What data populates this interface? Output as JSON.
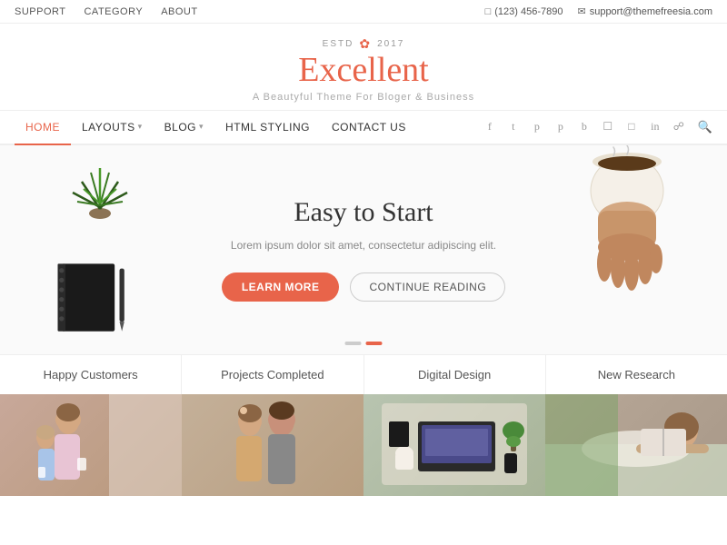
{
  "topbar": {
    "links": [
      "SUPPORT",
      "CATEGORY",
      "ABOUT"
    ],
    "phone": "(123) 456-7890",
    "email": "support@themefreesia.com"
  },
  "logo": {
    "estd": "ESTD",
    "year": "2017",
    "title_prefix": "E",
    "title_rest": "xcellent",
    "tagline": "A Beautyful Theme For Bloger & Business"
  },
  "nav": {
    "items": [
      {
        "label": "HOME",
        "active": true,
        "dropdown": false
      },
      {
        "label": "LAYOUTS",
        "active": false,
        "dropdown": true
      },
      {
        "label": "BLOG",
        "active": false,
        "dropdown": true
      },
      {
        "label": "HTML STYLING",
        "active": false,
        "dropdown": false
      },
      {
        "label": "CONTACT US",
        "active": false,
        "dropdown": false
      }
    ],
    "social_icons": [
      "f",
      "t",
      "p",
      "p2",
      "b",
      "i",
      "r",
      "in",
      "l"
    ]
  },
  "hero": {
    "title": "Easy to Start",
    "subtitle": "Lorem ipsum dolor sit amet, consectetur adipiscing elit.",
    "btn_learn": "LEARN MORE",
    "btn_continue": "CONTINUE READING"
  },
  "stats": {
    "items": [
      "Happy Customers",
      "Projects Completed",
      "Digital Design",
      "New Research"
    ]
  },
  "gallery": {
    "items": [
      {
        "bg": "#d4b8a8",
        "label": "couple1"
      },
      {
        "bg": "#c8b89a",
        "label": "couple2"
      },
      {
        "bg": "#a8b8a0",
        "label": "desk"
      },
      {
        "bg": "#c0b0a0",
        "label": "reading"
      }
    ]
  },
  "colors": {
    "accent": "#e8644a",
    "text_dark": "#333",
    "text_mid": "#888",
    "border": "#eee"
  }
}
